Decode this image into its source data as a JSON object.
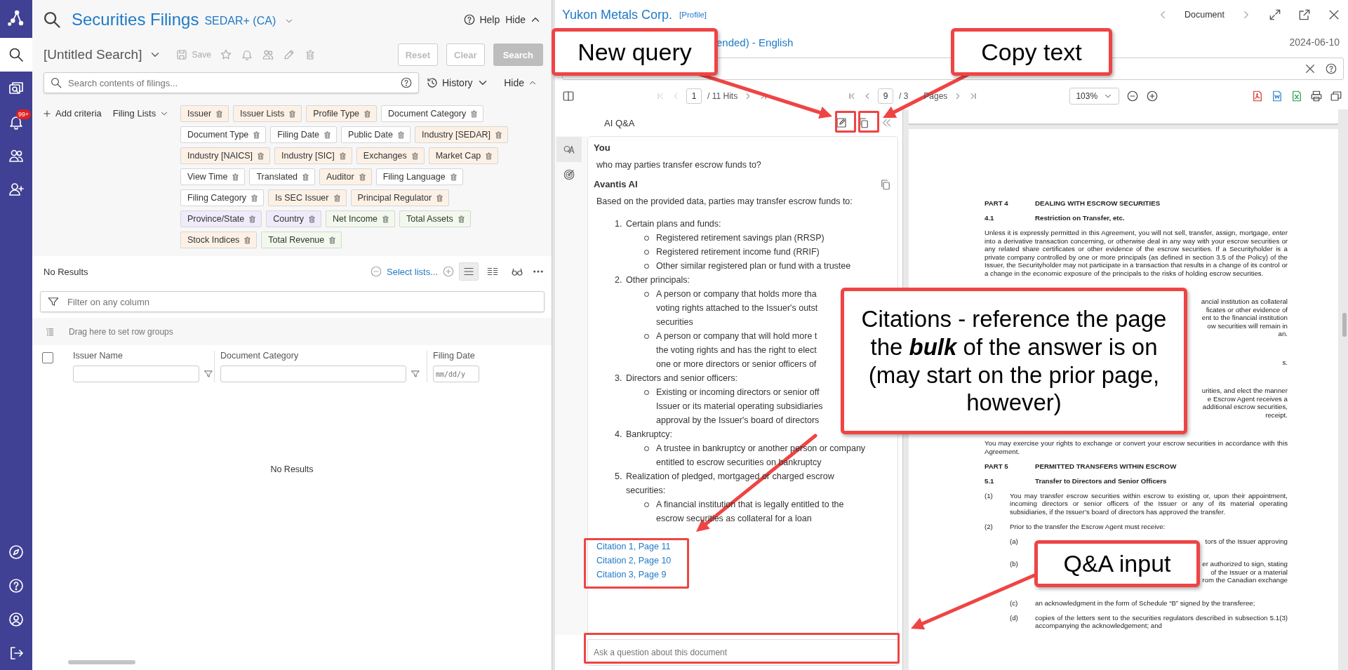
{
  "sidebar": {
    "top": [
      {
        "kind": "search",
        "selected": true
      },
      {
        "kind": "documents",
        "selected": false
      },
      {
        "kind": "alerts",
        "selected": false,
        "badge": "99+"
      },
      {
        "kind": "people",
        "selected": false
      },
      {
        "kind": "add-person",
        "selected": false
      }
    ],
    "bottom": [
      {
        "kind": "explore",
        "selected": false
      },
      {
        "kind": "help",
        "selected": false
      },
      {
        "kind": "account",
        "selected": false
      },
      {
        "kind": "logout",
        "selected": false
      }
    ]
  },
  "search": {
    "title": "Securities Filings",
    "source": "SEDAR+ (CA)",
    "help": "Help",
    "hide": "Hide",
    "search_name": "[Untitled Search]",
    "save": "Save",
    "buttons": [
      {
        "label": "Reset",
        "kind": "secondary",
        "disabled": true
      },
      {
        "label": "Clear",
        "kind": "secondary",
        "disabled": true
      },
      {
        "label": "Search",
        "kind": "primary",
        "disabled": true
      }
    ],
    "placeholder": "Search contents of filings...",
    "history": "History",
    "hide_criteria": "Hide",
    "add_criteria": "Add criteria",
    "filing_lists": "Filing Lists",
    "criteria": [
      [
        {
          "label": "Issuer",
          "color": "#fdf1e6"
        },
        {
          "label": "Issuer Lists",
          "color": "#fdf1e6"
        },
        {
          "label": "Profile Type",
          "color": "#fdf1e6"
        },
        {
          "label": "Document Category",
          "color": "#ffffff"
        }
      ],
      [
        {
          "label": "Document Type",
          "color": "#ffffff"
        },
        {
          "label": "Filing Date",
          "color": "#ffffff"
        },
        {
          "label": "Public Date",
          "color": "#ffffff"
        },
        {
          "label": "Industry [SEDAR]",
          "color": "#fdf1e6"
        }
      ],
      [
        {
          "label": "Industry [NAICS]",
          "color": "#fdf1e6"
        },
        {
          "label": "Industry [SIC]",
          "color": "#fdf1e6"
        },
        {
          "label": "Exchanges",
          "color": "#fdf1e6"
        },
        {
          "label": "Market Cap",
          "color": "#fdf1e6"
        }
      ],
      [
        {
          "label": "View Time",
          "color": "#ffffff"
        },
        {
          "label": "Translated",
          "color": "#ffffff"
        },
        {
          "label": "Auditor",
          "color": "#fdf1e6"
        },
        {
          "label": "Filing Language",
          "color": "#ffffff"
        }
      ],
      [
        {
          "label": "Filing Category",
          "color": "#ffffff"
        },
        {
          "label": "Is SEC Issuer",
          "color": "#fdf1e6"
        },
        {
          "label": "Principal Regulator",
          "color": "#fdf1e6"
        }
      ],
      [
        {
          "label": "Province/State",
          "color": "#efebfb"
        },
        {
          "label": "Country",
          "color": "#efebfb"
        },
        {
          "label": "Net Income",
          "color": "#f1f9ec"
        },
        {
          "label": "Total Assets",
          "color": "#f1f9ec"
        }
      ],
      [
        {
          "label": "Stock Indices",
          "color": "#fdf1e6"
        },
        {
          "label": "Total Revenue",
          "color": "#f1f9ec"
        }
      ]
    ]
  },
  "results": {
    "title": "No Results",
    "select_lists": "Select lists...",
    "views": [
      {
        "kind": "rows",
        "selected": true
      },
      {
        "kind": "columns",
        "selected": false
      }
    ],
    "filter_placeholder": "Filter on any column",
    "select_all": {
      "checked": false
    },
    "row_groups": "Drag here to set row groups",
    "columns": [
      {
        "label": "Issuer Name",
        "kind": "text"
      },
      {
        "label": "Document Category",
        "kind": "text"
      },
      {
        "label": "Filing Date",
        "kind": "date",
        "placeholder": "mm/dd/y"
      }
    ],
    "empty": "No Results"
  },
  "document": {
    "company": "Yukon Metals Corp.",
    "profile": "[Profile]",
    "nav_label": "Document",
    "subtitle": "ended) - English",
    "date": "2024-06-10",
    "hits": {
      "current": "1",
      "total": "/ 11 Hits"
    },
    "pages": {
      "current": "9",
      "total": "/ 3",
      "suffix": "Pages"
    },
    "zoom": "103%",
    "page": [
      {
        "kind": "part",
        "num": "PART 4",
        "text": "DEALING WITH ESCROW SECURITIES"
      },
      {
        "kind": "section",
        "num": "4.1",
        "text": "Restriction on Transfer, etc."
      },
      {
        "kind": "para",
        "text": "Unless it is expressly permitted in this Agreement, you will not sell, transfer, assign, mortgage, enter into a derivative transaction concerning, or otherwise deal in any way with your escrow securities or any related share certificates or other evidence of the escrow securities. If a Securityholder is a private company controlled by one or more principals (as defined in section 3.5 of the Policy) of the Issuer, the Securityholder may not participate in a transaction that results in a change of its control or a change in the economic exposure of the principals to the risks of holding escrow securities."
      },
      {
        "kind": "fragment",
        "lines": [
          "ancial institution as collateral",
          "ficates or other evidence of",
          "ent to the financial institution",
          "ow securities will remain in",
          "an."
        ]
      },
      {
        "kind": "fragment",
        "lines": [
          "s."
        ]
      },
      {
        "kind": "fragment",
        "lines": [
          "urities, and elect the manner",
          "e Escrow Agent receives a",
          "additional escrow securities,",
          "receipt."
        ]
      },
      {
        "kind": "para",
        "text": "You may exercise your rights to exchange or convert your escrow securities in accordance with this Agreement."
      },
      {
        "kind": "part",
        "num": "PART 5",
        "text": "PERMITTED TRANSFERS WITHIN ESCROW"
      },
      {
        "kind": "section",
        "num": "5.1",
        "text": "Transfer to Directors and Senior Officers"
      },
      {
        "kind": "item",
        "num": "(1)",
        "text": "You may transfer escrow securities within escrow to existing or, upon their appointment, incoming directors or senior officers of the Issuer or any of its material operating subsidiaries, if the Issuer’s board of directors has approved the transfer."
      },
      {
        "kind": "item",
        "num": "(2)",
        "text": "Prior to the transfer the Escrow Agent must receive:"
      },
      {
        "kind": "subfragment",
        "num": "(a)",
        "lines": [
          "tors of the Issuer approving"
        ]
      },
      {
        "kind": "subfragment",
        "num": "(b)",
        "lines": [
          "er authorized to sign, stating",
          "of the Issuer or a material",
          "rom the Canadian exchange"
        ]
      },
      {
        "kind": "subitem",
        "num": "(c)",
        "text": "an acknowledgment in the form of Schedule “B” signed by the transferee;"
      },
      {
        "kind": "subitem",
        "num": "(d)",
        "text": "copies of the letters sent to the securities regulators described in subsection 5.1(3) accompanying the acknowledgement; and"
      }
    ]
  },
  "qa": {
    "title": "AI Q&A",
    "tabs": [
      {
        "kind": "qa",
        "selected": true
      },
      {
        "kind": "target",
        "selected": false
      }
    ],
    "user_label": "You",
    "question": "who may parties transfer escrow funds to?",
    "ai_label": "Avantis AI",
    "intro": "Based on the provided data, parties may transfer escrow funds to:",
    "items": [
      {
        "num": "1.",
        "title": [
          "Certain plans and funds:"
        ],
        "bullets": [
          [
            "Registered retirement savings plan (RRSP)"
          ],
          [
            "Registered retirement income fund (RRIF)"
          ],
          [
            "Other similar registered plan or fund with a trustee"
          ]
        ]
      },
      {
        "num": "2.",
        "title": [
          "Other principals:"
        ],
        "bullets": [
          [
            "A person or company that holds more tha",
            "voting rights attached to the Issuer's outst",
            "securities"
          ],
          [
            "A person or company that will hold more t",
            "the voting rights and has the right to elect",
            "one or more directors or senior officers of"
          ]
        ]
      },
      {
        "num": "3.",
        "title": [
          "Directors and senior officers:"
        ],
        "bullets": [
          [
            "Existing or incoming directors or senior off",
            "Issuer or its material operating subsidiaries",
            "approval by the Issuer's board of directors"
          ]
        ]
      },
      {
        "num": "4.",
        "title": [
          "Bankruptcy:"
        ],
        "bullets": [
          [
            "A trustee in bankruptcy or another person or company",
            "entitled to escrow securities on bankruptcy"
          ]
        ]
      },
      {
        "num": "5.",
        "title": [
          "Realization of pledged, mortgaged or charged escrow",
          "securities:"
        ],
        "bullets": [
          [
            "A financial institution that is legally entitled to the",
            "escrow securities as collateral for a loan"
          ]
        ]
      }
    ],
    "citations": [
      "Citation 1, Page 11",
      "Citation 2, Page 10",
      "Citation 3, Page 9"
    ],
    "input_placeholder": "Ask a question about this document"
  },
  "callouts": [
    "New query",
    "Copy text",
    "Citations - reference the page the **bulk** of the answer is on (may start on the prior page, however)",
    "Q&A input"
  ]
}
